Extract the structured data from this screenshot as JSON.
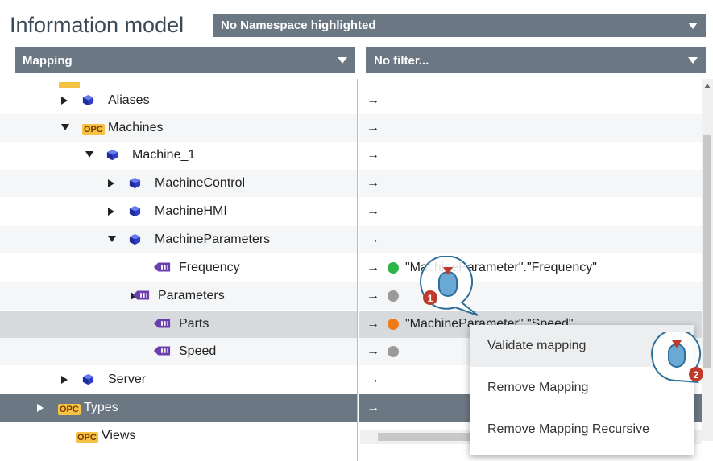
{
  "header": {
    "title": "Information model",
    "namespace_select": "No Namespace highlighted"
  },
  "left_filter": {
    "value": "Mapping"
  },
  "right_filter": {
    "value": "No filter..."
  },
  "tree": [
    {
      "label": "Aliases",
      "expand": "collapsed",
      "icon": "object-cube-icon",
      "mapping": ""
    },
    {
      "label": "Machines",
      "expand": "expanded",
      "icon": "opc-folder-icon",
      "mapping": ""
    },
    {
      "label": "Machine_1",
      "expand": "expanded",
      "icon": "object-cube-icon",
      "mapping": ""
    },
    {
      "label": "MachineControl",
      "expand": "collapsed",
      "icon": "object-cube-icon",
      "mapping": ""
    },
    {
      "label": "MachineHMI",
      "expand": "collapsed",
      "icon": "object-cube-icon",
      "mapping": ""
    },
    {
      "label": "MachineParameters",
      "expand": "expanded",
      "icon": "object-cube-icon",
      "mapping": ""
    },
    {
      "label": "Frequency",
      "expand": "none",
      "icon": "variable-icon",
      "mapping": "\"MachineParameter\".\"Frequency\"",
      "status": "valid"
    },
    {
      "label": "Parameters",
      "expand": "collapsed",
      "icon": "variable-icon",
      "mapping": "",
      "status": "unknown"
    },
    {
      "label": "Parts",
      "expand": "none",
      "icon": "variable-icon",
      "mapping": "\"MachineParameter\".\"Speed\"",
      "status": "warning"
    },
    {
      "label": "Speed",
      "expand": "none",
      "icon": "variable-icon",
      "mapping": "",
      "status": "unknown"
    },
    {
      "label": "Server",
      "expand": "collapsed",
      "icon": "object-cube-icon",
      "mapping": ""
    },
    {
      "label": "Types",
      "expand": "collapsed",
      "icon": "opc-folder-icon",
      "mapping": ""
    },
    {
      "label": "Views",
      "expand": "none",
      "icon": "opc-folder-icon",
      "mapping": ""
    }
  ],
  "mapping_arrow": "→",
  "opc_text": "OPC",
  "context_menu": {
    "items": [
      "Validate mapping",
      "Remove Mapping",
      "Remove Mapping Recursive"
    ]
  },
  "markers": {
    "step1": "1",
    "step2": "2"
  },
  "colors": {
    "header_bar": "#6b7783",
    "status_valid": "#2fb34a",
    "status_warning": "#f07a1a",
    "status_unknown": "#9a9a9a",
    "opc": "#f6c244",
    "cube": "#2d3fc9"
  }
}
